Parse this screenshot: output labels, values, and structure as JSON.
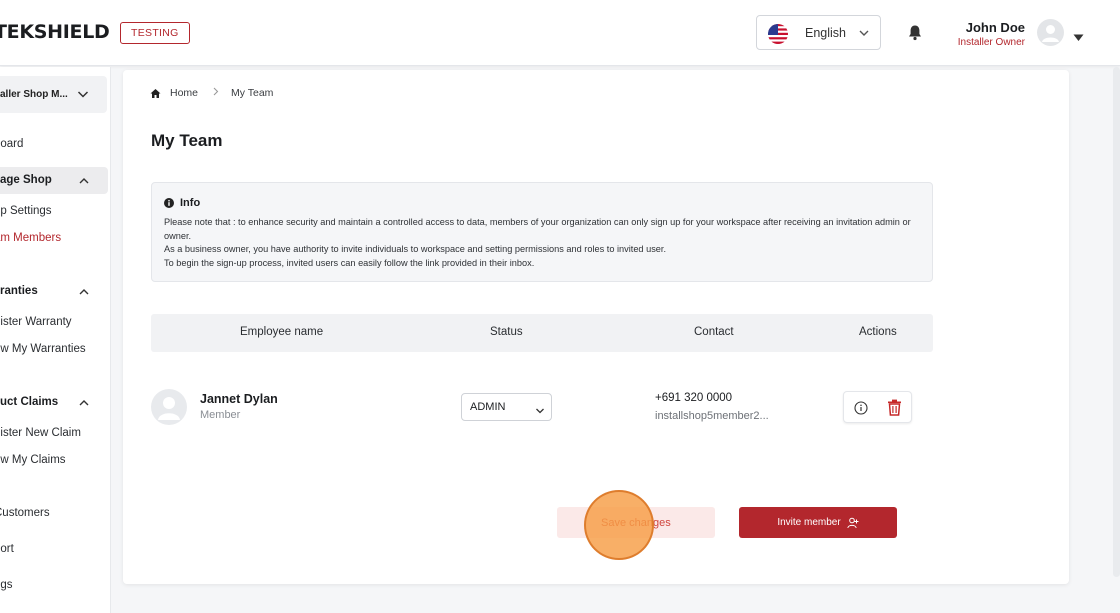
{
  "header": {
    "logo": "TEKSHIELD",
    "env_badge": "TESTING",
    "language": "English",
    "user_name": "John Doe",
    "user_role": "Installer Owner"
  },
  "sidebar": {
    "shop_selector": "aller Shop M...",
    "items": [
      {
        "label": "board",
        "type": "item"
      },
      {
        "label": "age Shop",
        "type": "section",
        "expanded": true
      },
      {
        "label": "op Settings",
        "type": "item"
      },
      {
        "label": "am Members",
        "type": "item",
        "active": true
      },
      {
        "label": "ranties",
        "type": "section",
        "expanded": true
      },
      {
        "label": "gister Warranty",
        "type": "item"
      },
      {
        "label": "ew My Warranties",
        "type": "item"
      },
      {
        "label": "uct Claims",
        "type": "section",
        "expanded": true
      },
      {
        "label": "gister New Claim",
        "type": "item"
      },
      {
        "label": "ew My Claims",
        "type": "item"
      },
      {
        "label": "Customers",
        "type": "item"
      },
      {
        "label": "port",
        "type": "item"
      },
      {
        "label": "ngs",
        "type": "item"
      }
    ]
  },
  "breadcrumb": {
    "home": "Home",
    "current": "My Team"
  },
  "page_title": "My Team",
  "info": {
    "title": "Info",
    "lines": [
      "Please note that : to enhance security and maintain a controlled access to data, members of your organization can only sign up for your workspace after receiving an invitation admin or owner.",
      "As a business owner, you have authority to invite individuals to workspace and setting permissions and roles to invited user.",
      "To begin the sign-up process, invited users can easily follow the link provided in their inbox."
    ]
  },
  "table": {
    "headers": [
      "Employee name",
      "Status",
      "Contact",
      "Actions"
    ],
    "rows": [
      {
        "name": "Jannet Dylan",
        "role": "Member",
        "status": "ADMIN",
        "phone": "+691 320 0000",
        "email": "installshop5member2..."
      }
    ]
  },
  "buttons": {
    "save": "Save changes",
    "invite": "Invite member"
  },
  "colors": {
    "brand": "#b3272d",
    "click_highlight": "#f69e46"
  }
}
